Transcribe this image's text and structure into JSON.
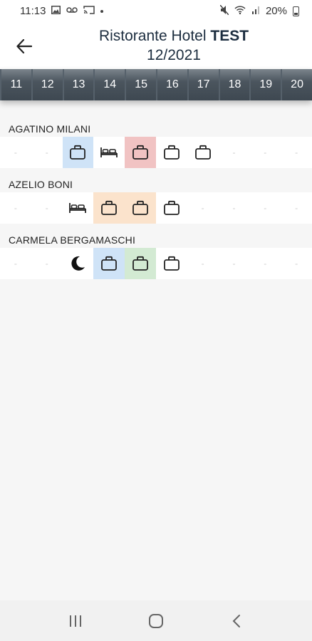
{
  "status_bar": {
    "time": "11:13",
    "battery": "20%",
    "icons": [
      "image-icon",
      "voicemail-icon",
      "cast-icon",
      "dot-icon",
      "mute-icon",
      "wifi-icon",
      "signal-icon",
      "battery-icon"
    ]
  },
  "header": {
    "title_part1": "Ristorante Hotel",
    "title_part2": "TEST",
    "period": "12/2021",
    "back_icon": "arrow-left-icon"
  },
  "days": [
    "11",
    "12",
    "13",
    "14",
    "15",
    "16",
    "17",
    "18",
    "19",
    "20"
  ],
  "colors": {
    "blue": "#cfe3f7",
    "red": "#f1c3c3",
    "orange": "#fbe3cc",
    "green": "#d3ead3",
    "header_text": "#1c2d3f",
    "day_strip": "#4b555e"
  },
  "staff": [
    {
      "name": "AGATINO MILANI",
      "cells": [
        {
          "icon": "dash",
          "text": "-"
        },
        {
          "icon": "dash",
          "text": "-"
        },
        {
          "icon": "briefcase-icon",
          "bg": "blue"
        },
        {
          "icon": "bed-icon"
        },
        {
          "icon": "briefcase-icon",
          "bg": "red"
        },
        {
          "icon": "briefcase-icon"
        },
        {
          "icon": "briefcase-icon"
        },
        {
          "icon": "dash",
          "text": "-"
        },
        {
          "icon": "dash",
          "text": "-"
        },
        {
          "icon": "dash",
          "text": "-"
        }
      ]
    },
    {
      "name": "AZELIO BONI",
      "cells": [
        {
          "icon": "dash",
          "text": "-"
        },
        {
          "icon": "dash",
          "text": "-"
        },
        {
          "icon": "bed-icon"
        },
        {
          "icon": "briefcase-icon",
          "bg": "orange"
        },
        {
          "icon": "briefcase-icon",
          "bg": "orange"
        },
        {
          "icon": "briefcase-icon"
        },
        {
          "icon": "dash",
          "text": "-"
        },
        {
          "icon": "dash",
          "text": "-"
        },
        {
          "icon": "dash",
          "text": "-"
        },
        {
          "icon": "dash",
          "text": "-"
        }
      ]
    },
    {
      "name": "CARMELA BERGAMASCHI",
      "cells": [
        {
          "icon": "dash",
          "text": "-"
        },
        {
          "icon": "dash",
          "text": "-"
        },
        {
          "icon": "moon-icon"
        },
        {
          "icon": "briefcase-icon",
          "bg": "blue"
        },
        {
          "icon": "briefcase-icon",
          "bg": "green"
        },
        {
          "icon": "briefcase-icon"
        },
        {
          "icon": "dash",
          "text": "-"
        },
        {
          "icon": "dash",
          "text": "-"
        },
        {
          "icon": "dash",
          "text": "-"
        },
        {
          "icon": "dash",
          "text": "-"
        }
      ]
    }
  ],
  "nav_bar": {
    "icons": [
      "recent-apps-icon",
      "home-icon",
      "back-icon"
    ]
  }
}
